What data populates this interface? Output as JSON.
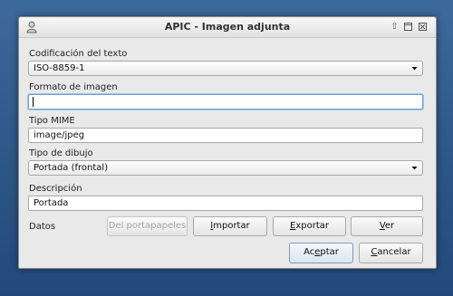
{
  "window": {
    "title": "APIC - Imagen adjunta",
    "buttons": [
      "shade",
      "maximize",
      "close"
    ]
  },
  "encoding": {
    "label": "Codificación del texto",
    "value": "ISO-8859-1"
  },
  "image_format": {
    "label": "Formato de imagen",
    "value": ""
  },
  "mime_type": {
    "label": "Tipo MIME",
    "value": "image/jpeg"
  },
  "picture_type": {
    "label": "Tipo de dibujo",
    "value": "Portada (frontal)"
  },
  "description": {
    "label": "Descripción",
    "value": "Portada"
  },
  "data_row": {
    "label": "Datos",
    "from_clipboard": {
      "label": "Del portapapeles",
      "enabled": false
    },
    "import": {
      "mnemonic": "I",
      "rest": "mportar"
    },
    "export": {
      "mnemonic": "E",
      "rest": "xportar"
    },
    "view": {
      "mnemonic": "V",
      "rest": "er"
    }
  },
  "footer": {
    "accept": {
      "pre": "Ac",
      "mnemonic": "e",
      "rest": "ptar"
    },
    "cancel": {
      "mnemonic": "C",
      "rest": "ancelar"
    }
  }
}
